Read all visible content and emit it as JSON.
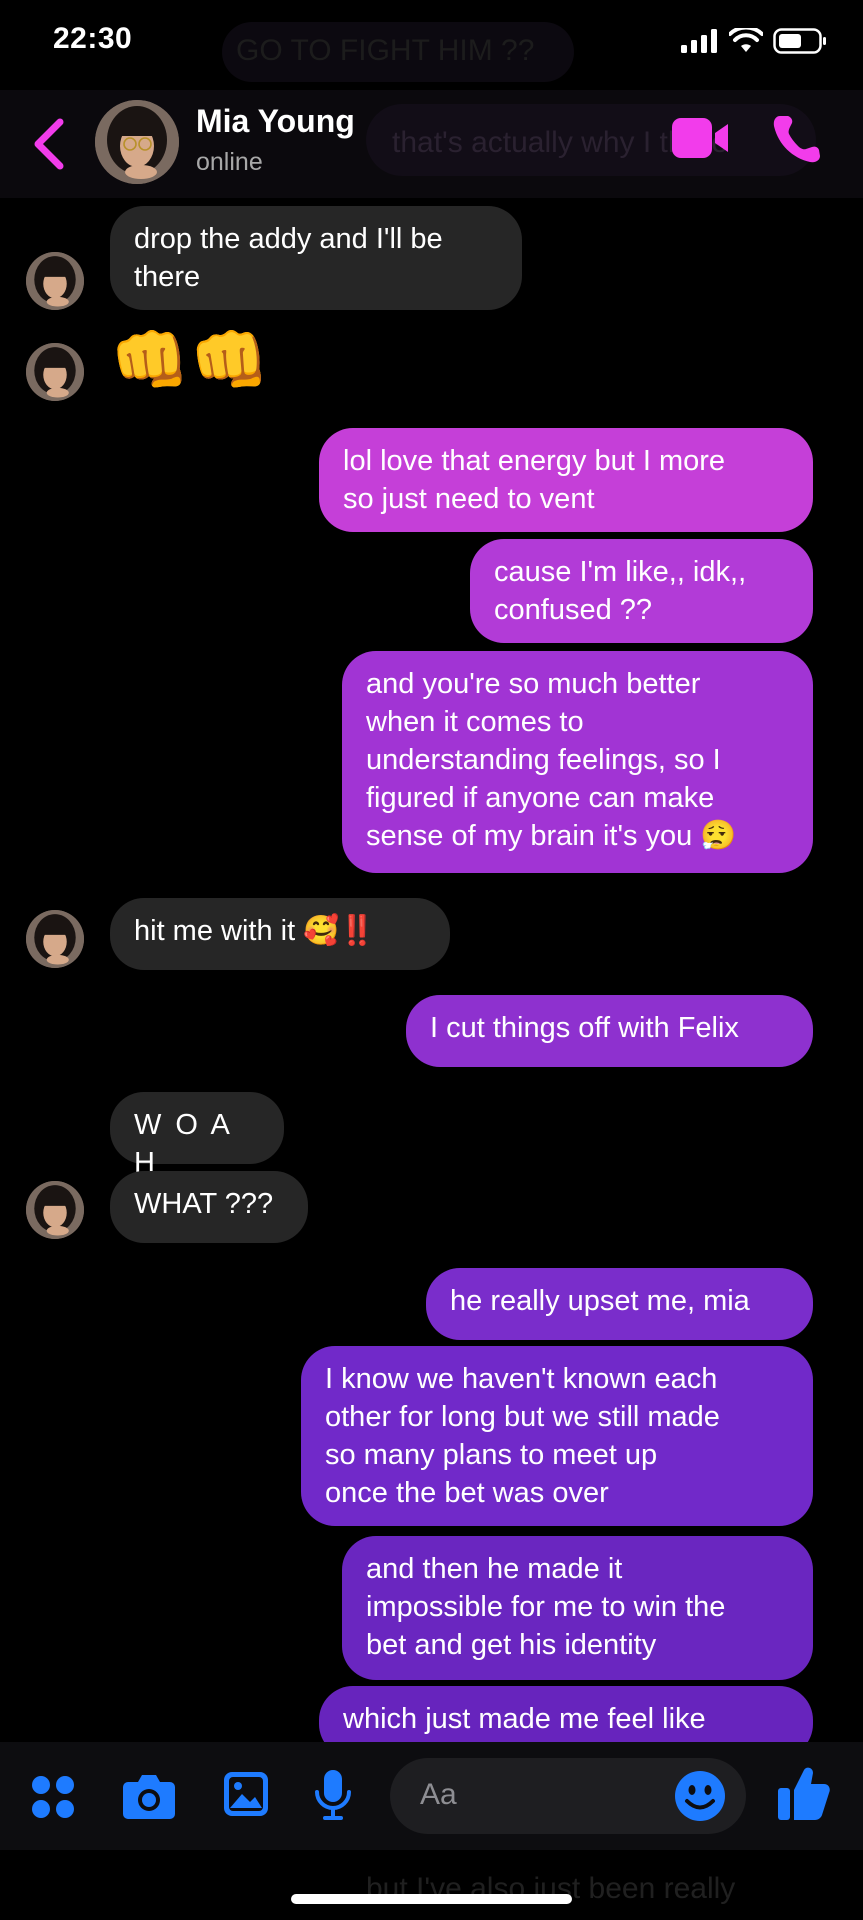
{
  "status_bar": {
    "time": "22:30"
  },
  "header": {
    "contact_name": "Mia Young",
    "contact_status": "online"
  },
  "background_ghost_text": {
    "top": "GO TO FIGHT HIM ??",
    "header": "that's actually why I there",
    "bottom": "but I've also just been really"
  },
  "messages": [
    {
      "from": "them",
      "text": "drop the addy and I'll be\nthere"
    },
    {
      "from": "them",
      "emoji": "👊👊"
    },
    {
      "from": "me",
      "text": "lol love that energy but I more\nso just need to vent"
    },
    {
      "from": "me",
      "text": "cause I'm like,, idk,,\nconfused ??"
    },
    {
      "from": "me",
      "text": "and you're so much better\nwhen it comes to\nunderstanding feelings, so I\nfigured if anyone can make\nsense of my brain it's you 😮‍💨"
    },
    {
      "from": "them",
      "text": "hit me with it 🥰‼️"
    },
    {
      "from": "me",
      "text": "I cut things off with Felix"
    },
    {
      "from": "them",
      "text": "W O A H"
    },
    {
      "from": "them",
      "text": "WHAT ???"
    },
    {
      "from": "me",
      "text": "he really upset me, mia"
    },
    {
      "from": "me",
      "text": "I know we haven't known each\nother for long but we still made\nso many plans to meet up\nonce the bet was over"
    },
    {
      "from": "me",
      "text": "and then he made it\nimpossible for me to win the\nbet and get his identity"
    },
    {
      "from": "me",
      "text": "which just made me feel like"
    }
  ],
  "composer": {
    "placeholder": "Aa"
  },
  "colors": {
    "accent": "#F23CEB",
    "bubble_out_top": "#C53FD8",
    "bubble_out_bottom": "#6A26C0",
    "bubble_in": "#262626",
    "composer_icon": "#1E7BFF"
  },
  "icons": [
    "back-chevron-icon",
    "video-camera-icon",
    "phone-icon",
    "grid-icon",
    "camera-icon",
    "image-icon",
    "microphone-icon",
    "emoji-icon",
    "thumbs-up-icon"
  ]
}
